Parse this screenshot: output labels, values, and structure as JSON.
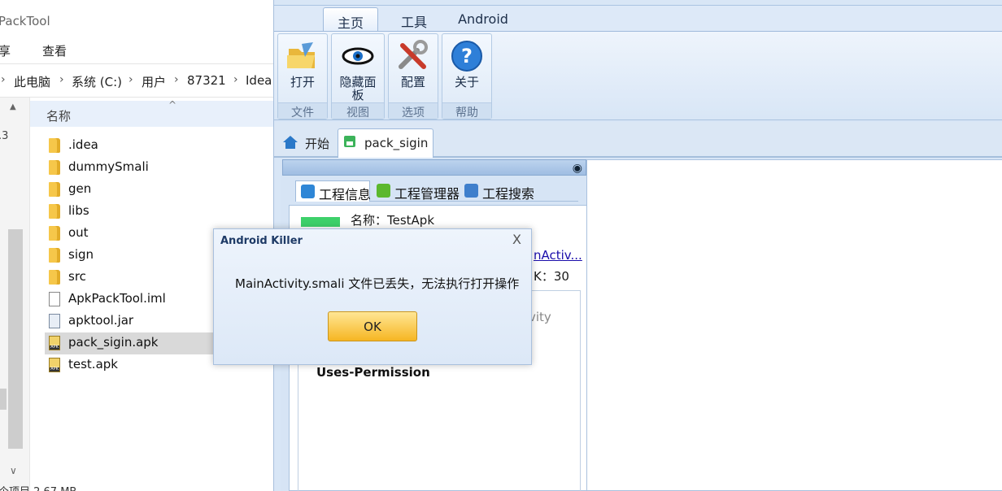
{
  "explorer": {
    "title": "PackTool",
    "menu": [
      "享",
      "查看"
    ],
    "address": [
      "此电脑",
      "系统 (C:)",
      "用户",
      "87321",
      "Idea"
    ],
    "column_header": "名称",
    "left_stub": ".3",
    "files": [
      {
        "name": ".idea",
        "icon": "folder-icon"
      },
      {
        "name": "dummySmali",
        "icon": "folder-icon"
      },
      {
        "name": "gen",
        "icon": "folder-icon"
      },
      {
        "name": "libs",
        "icon": "folder-icon"
      },
      {
        "name": "out",
        "icon": "folder-icon"
      },
      {
        "name": "sign",
        "icon": "folder-icon"
      },
      {
        "name": "src",
        "icon": "folder-icon"
      },
      {
        "name": "ApkPackTool.iml",
        "icon": "document-icon"
      },
      {
        "name": "apktool.jar",
        "icon": "jar-file-icon"
      },
      {
        "name": "pack_sigin.apk",
        "icon": "apk-file-icon",
        "selected": true
      },
      {
        "name": "test.apk",
        "icon": "apk-file-icon"
      }
    ],
    "status": "个项目 2.67 MB"
  },
  "ak": {
    "ribbon_tabs": [
      "主页",
      "工具",
      "Android"
    ],
    "groups": [
      {
        "button": "打开",
        "group": "文件",
        "icon": "folder-open-icon"
      },
      {
        "button": "隐藏面板",
        "group": "视图",
        "icon": "eye-icon"
      },
      {
        "button": "配置",
        "group": "选项",
        "icon": "tools-icon"
      },
      {
        "button": "关于",
        "group": "帮助",
        "icon": "help-icon"
      }
    ],
    "doc_tabs": [
      "开始",
      "pack_sigin"
    ],
    "sub_tabs": [
      "工程信息",
      "工程管理器",
      "工程搜索"
    ],
    "info": {
      "name": "名称：TestApk",
      "activity": "nActiv...",
      "sdk": "K：30",
      "vity": "vity",
      "perm": "Uses-Permission"
    }
  },
  "dialog": {
    "title": "Android Killer",
    "message": "MainActivity.smali 文件已丢失，无法执行打开操作",
    "ok_label": "OK",
    "close_glyph": "X"
  },
  "colors": {
    "ribbon_bg": "#d8e6f6",
    "ok_button": "#f6b623",
    "link": "#1a0dab",
    "status_green": "#3dd06a"
  }
}
